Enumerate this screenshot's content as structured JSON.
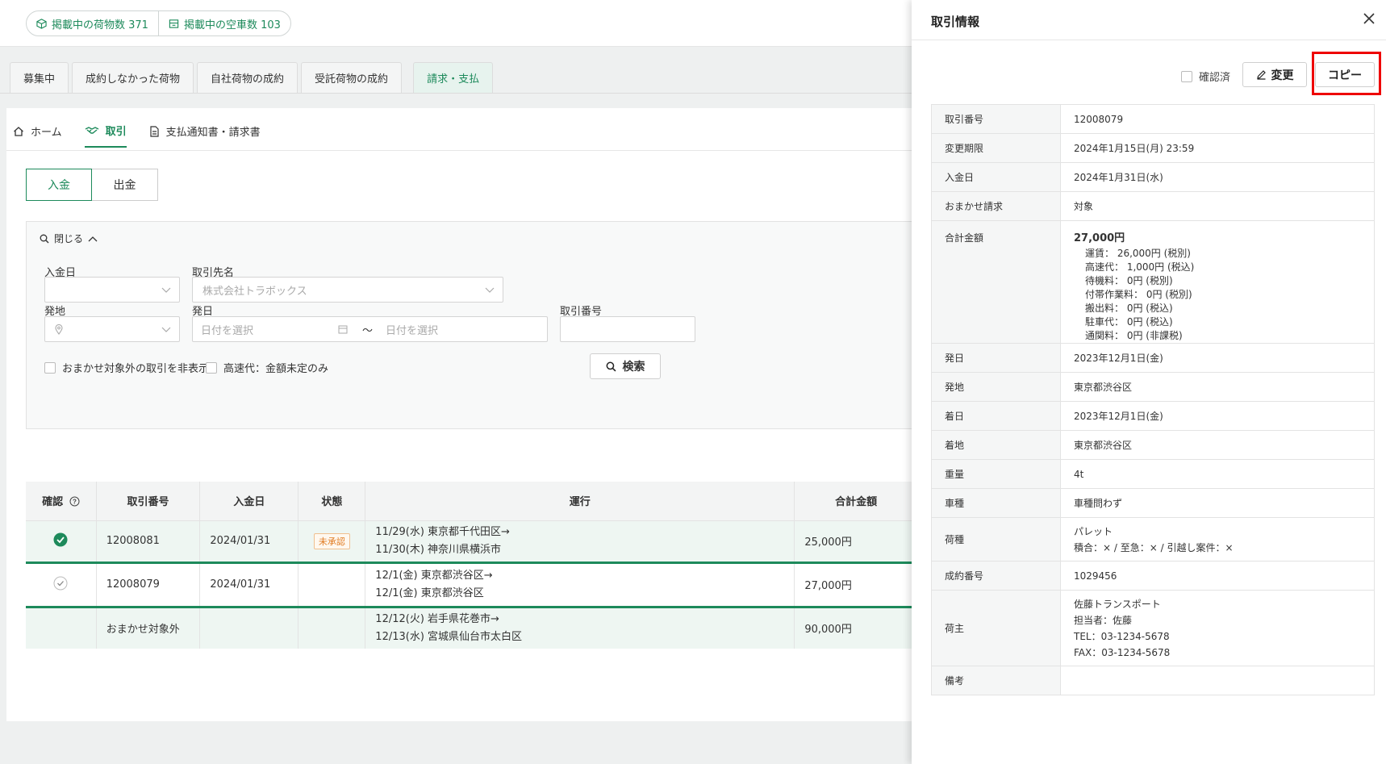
{
  "topbar": {
    "stat1": "掲載中の荷物数 371",
    "stat2": "掲載中の空車数 103"
  },
  "tabs": [
    {
      "label": "募集中"
    },
    {
      "label": "成約しなかった荷物"
    },
    {
      "label": "自社荷物の成約"
    },
    {
      "label": "受託荷物の成約"
    },
    {
      "label": "請求・支払"
    }
  ],
  "subnav": {
    "home": "ホーム",
    "trade": "取引",
    "docs": "支払通知書・請求書"
  },
  "segment": {
    "in": "入金",
    "out": "出金"
  },
  "filter": {
    "toggle": "閉じる",
    "payment_date_label": "入金日",
    "partner_label": "取引先名",
    "partner_placeholder": "株式会社トラボックス",
    "origin_label": "発地",
    "depart_label": "発日",
    "date_placeholder_from": "日付を選択",
    "tilde": "～",
    "date_placeholder_to": "日付を選択",
    "trade_no_label": "取引番号",
    "chk_hide_non_omakase": "おまかせ対象外の取引を非表示",
    "chk_highway_undetermined": "高速代：金額未定のみ",
    "search_btn": "検索"
  },
  "table": {
    "headers": [
      "確認",
      "取引番号",
      "入金日",
      "状態",
      "運行",
      "合計金額"
    ],
    "rows": [
      {
        "no": "12008081",
        "date": "2024/01/31",
        "status": "未承認",
        "route1": "11/29(水) 東京都千代田区→",
        "route2": "11/30(木) 神奈川県横浜市",
        "amount": "25,000円"
      },
      {
        "no": "12008079",
        "date": "2024/01/31",
        "status": "",
        "route1": "12/1(金) 東京都渋谷区→",
        "route2": "12/1(金) 東京都渋谷区",
        "amount": "27,000円"
      },
      {
        "no": "おまかせ対象外",
        "date": "",
        "status": "",
        "route1": "12/12(火) 岩手県花巻市→",
        "route2": "12/13(水) 宮城県仙台市太白区",
        "amount": "90,000円"
      }
    ]
  },
  "drawer": {
    "title": "取引情報",
    "confirmed_label": "確認済",
    "edit_btn": "変更",
    "copy_btn": "コピー",
    "rows": {
      "trade_no_k": "取引番号",
      "trade_no_v": "12008079",
      "deadline_k": "変更期限",
      "deadline_v": "2024年1月15日(月) 23:59",
      "payday_k": "入金日",
      "payday_v": "2024年1月31日(水)",
      "omakase_k": "おまかせ請求",
      "omakase_v": "対象",
      "total_k": "合計金額",
      "total_v": "27,000円",
      "total_lines": [
        "運賃： 26,000円 (税別)",
        "高速代： 1,000円 (税込)",
        "待機料： 0円 (税別)",
        "付帯作業料： 0円 (税別)",
        "搬出料： 0円 (税込)",
        "駐車代： 0円 (税込)",
        "通関料： 0円 (非課税)"
      ],
      "depday_k": "発日",
      "depday_v": "2023年12月1日(金)",
      "origin_k": "発地",
      "origin_v": "東京都渋谷区",
      "arrday_k": "着日",
      "arrday_v": "2023年12月1日(金)",
      "dest_k": "着地",
      "dest_v": "東京都渋谷区",
      "weight_k": "重量",
      "weight_v": "4t",
      "vehicle_k": "車種",
      "vehicle_v": "車種問わず",
      "cargo_k": "荷種",
      "cargo_v1": "パレット",
      "cargo_v2": "積合：× / 至急：× / 引越し案件：×",
      "contract_k": "成約番号",
      "contract_v": "1029456",
      "shipper_k": "荷主",
      "shipper_v1": "佐藤トランスポート",
      "shipper_v2": "担当者：佐藤",
      "shipper_v3": "TEL：03-1234-5678",
      "shipper_v4": "FAX：03-1234-5678",
      "note_k": "備考",
      "note_v": ""
    }
  },
  "colors": {
    "accent": "#1d8a5b",
    "highlight": "#e00000",
    "warning": "#e07a20"
  }
}
